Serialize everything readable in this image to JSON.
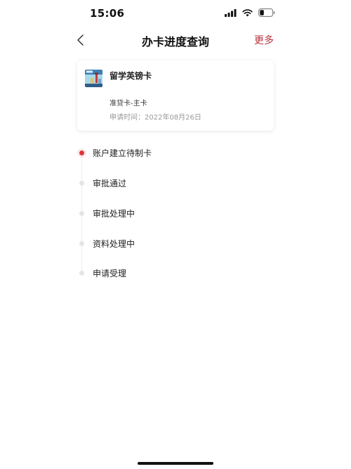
{
  "status": {
    "time": "15:06",
    "icons": [
      "signal-icon",
      "wifi-icon",
      "battery-icon"
    ]
  },
  "nav": {
    "back_icon": "chevron-left-icon",
    "title": "办卡进度查询",
    "more_label": "更多"
  },
  "card": {
    "name": "留学英镑卡",
    "type": "准贷卡-主卡",
    "apply_date": "申请时间：2022年08月26日"
  },
  "timeline": [
    {
      "label": "账户建立待制卡",
      "active": true
    },
    {
      "label": "审批通过",
      "active": false
    },
    {
      "label": "审批处理中",
      "active": false
    },
    {
      "label": "资料处理中",
      "active": false
    },
    {
      "label": "申请受理",
      "active": false
    }
  ],
  "colors": {
    "accent": "#e0333c",
    "more_text": "#b8323e",
    "inactive_dot": "#e5e5e5",
    "secondary_text": "#999999"
  }
}
